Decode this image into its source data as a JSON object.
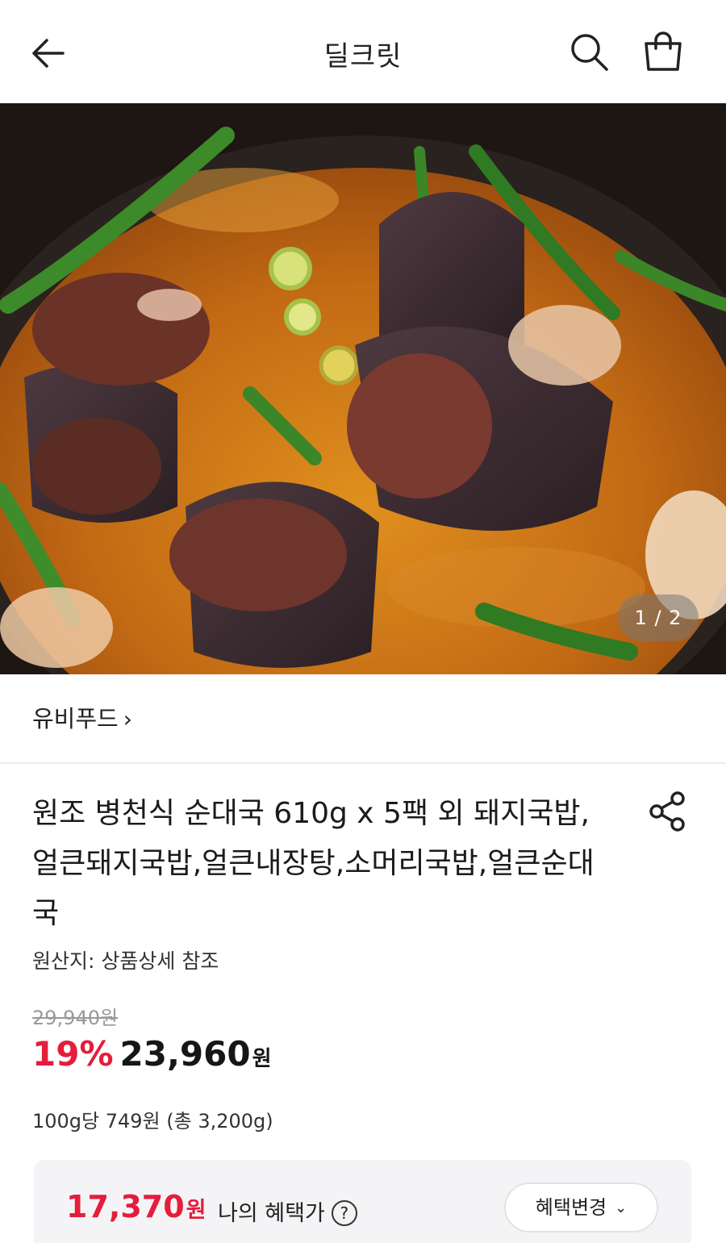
{
  "header": {
    "title": "딜크릿",
    "back_icon": "arrow-left-icon",
    "search_icon": "search-icon",
    "cart_icon": "shopping-bag-icon"
  },
  "gallery": {
    "counter": "1 / 2",
    "image_alt": "soondae-gukbap-photo"
  },
  "store": {
    "name": "유비푸드",
    "chevron": "›"
  },
  "product": {
    "title": "원조 병천식 순대국 610g x 5팩 외 돼지국밥,얼큰돼지국밥,얼큰내장탕,소머리국밥,얼큰순대국",
    "origin": "원산지: 상품상세 참조",
    "original_price": "29,940원",
    "discount": "19%",
    "price": "23,960",
    "price_unit": "원",
    "unit_price": "100g당 749원 (총 3,200g)"
  },
  "benefit": {
    "price": "17,370",
    "price_unit": "원",
    "label": "나의 혜택가",
    "help": "?",
    "change_button": "혜택변경",
    "change_chevron": "⌄"
  },
  "colors": {
    "accent": "#e51d3c",
    "text": "#1b1b1b",
    "muted": "#999999",
    "panel": "#f4f4f6"
  }
}
